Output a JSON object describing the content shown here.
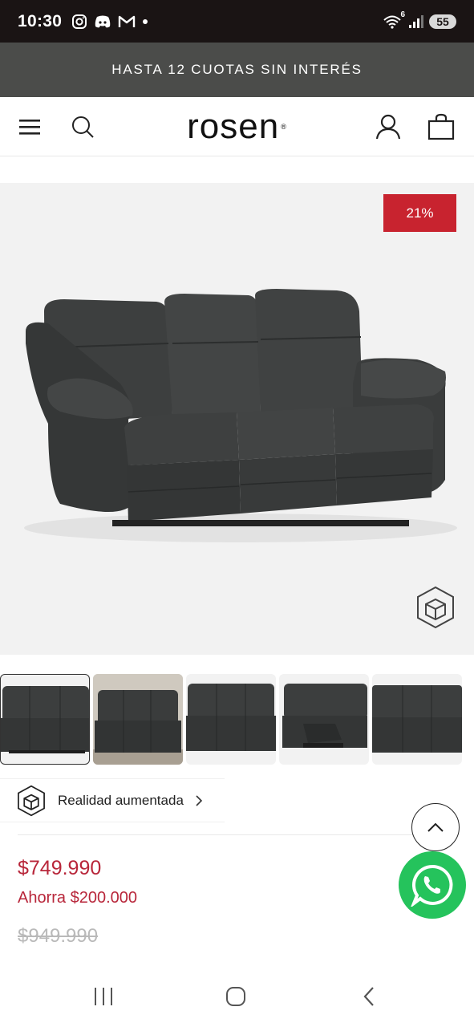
{
  "status_bar": {
    "time": "10:30",
    "left_icons": [
      "instagram-icon",
      "discord-icon",
      "gmail-icon",
      "dot-icon"
    ],
    "right_icons": [
      "wifi-icon",
      "signal-icon"
    ],
    "wifi_badge": "6",
    "battery": "55"
  },
  "promo": {
    "text": "HASTA 12 CUOTAS SIN INTERÉS"
  },
  "header": {
    "logo": "rosen",
    "logo_mark": "®",
    "icons": [
      "menu-icon",
      "search-icon",
      "account-icon",
      "cart-icon"
    ]
  },
  "product": {
    "discount_badge": "21%",
    "colors": {
      "leather": "#3b3d3d",
      "badge": "#c8232f",
      "price": "#b8263a"
    }
  },
  "thumbnails": [
    {
      "label": "thumb-1",
      "active": true
    },
    {
      "label": "thumb-2",
      "active": false
    },
    {
      "label": "thumb-3",
      "active": false
    },
    {
      "label": "thumb-4",
      "active": false
    },
    {
      "label": "thumb-5",
      "active": false
    }
  ],
  "ar": {
    "label": "Realidad aumentada"
  },
  "pricing": {
    "current": "$749.990",
    "savings": "Ahorra $200.000",
    "original": "$949.990"
  },
  "floating": {
    "whatsapp_color": "#25c35c"
  }
}
